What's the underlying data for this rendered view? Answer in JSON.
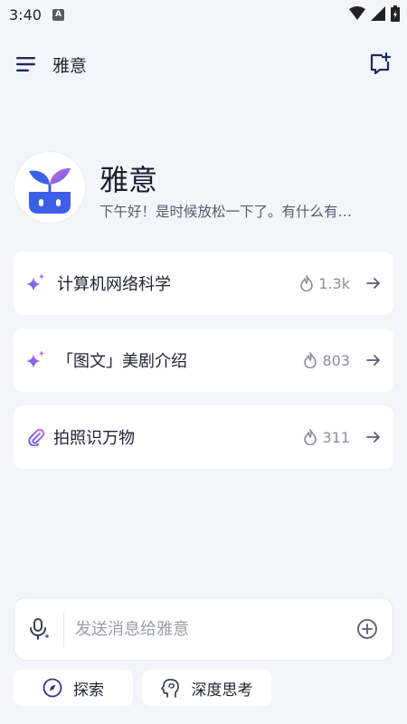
{
  "status": {
    "time": "3:40",
    "notice_letter": "A"
  },
  "header": {
    "title": "雅意",
    "menu_icon": "menu-icon",
    "new_chat_icon": "new-chat-icon"
  },
  "profile": {
    "name": "雅意",
    "greeting": "下午好！是时候放松一下了。有什么有…",
    "avatar_icon": "sprout-robot-logo"
  },
  "suggestions": [
    {
      "title": "计算机网络科学",
      "count": "1.3k",
      "icon": "sparkle-icon"
    },
    {
      "title": "「图文」美剧介绍",
      "count": "803",
      "icon": "sparkle-icon"
    },
    {
      "title": "拍照识万物",
      "count": "311",
      "icon": "paperclip-icon"
    }
  ],
  "composer": {
    "placeholder": "发送消息给雅意",
    "value": ""
  },
  "chips": [
    {
      "label": "探索",
      "icon": "compass-icon"
    },
    {
      "label": "深度思考",
      "icon": "head-brain-icon"
    }
  ],
  "colors": {
    "accent": "#4a5be0",
    "background": "#f4f5fa",
    "card": "#ffffff",
    "sparkle_start": "#5b6bf0",
    "sparkle_end": "#c86de0"
  }
}
